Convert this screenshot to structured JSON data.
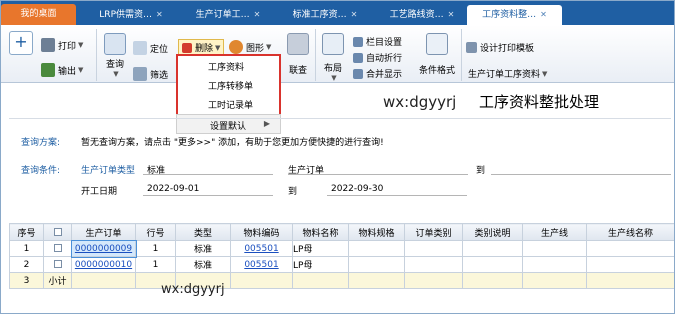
{
  "tabs": [
    {
      "label": "我的桌面"
    },
    {
      "label": "LRP供需资…"
    },
    {
      "label": "生产订单工…"
    },
    {
      "label": "标准工序资…"
    },
    {
      "label": "工艺路线资…"
    },
    {
      "label": "工序资料整…"
    }
  ],
  "ribbon": {
    "add": "+",
    "print": "打印",
    "output": "输出",
    "query": "查询",
    "locate": "定位",
    "filter": "筛选",
    "delete": "删除",
    "chart": "图形",
    "link": "联查",
    "layout": "布局",
    "col_settings": "栏目设置",
    "auto_wrap": "自动折行",
    "merge_display": "合并显示",
    "cond_format": "条件格式",
    "design_print": "设计打印模板",
    "mo_process": "生产订单工序资料"
  },
  "menu": {
    "items": [
      "工序资料",
      "工序转移单",
      "工时记录单"
    ],
    "defaults": "设置默认"
  },
  "watermark": "wx:dgyyrj",
  "page_title": "工序资料整批处理",
  "query": {
    "scheme_label": "查询方案:",
    "scheme_text": "暂无查询方案，请点击 \"更多>>\" 添加，有助于您更加方便快捷的进行查询!",
    "cond_label": "查询条件:",
    "mo_type_label": "生产订单类型",
    "mo_type_value": "标准",
    "mo_label": "生产订单",
    "to1": "到",
    "start_label": "开工日期",
    "start_from": "2022-09-01",
    "to2": "到",
    "start_to": "2022-09-30"
  },
  "table": {
    "headers": [
      "序号",
      "",
      "生产订单",
      "行号",
      "类型",
      "物料编码",
      "物料名称",
      "物料规格",
      "订单类别",
      "类别说明",
      "生产线",
      "生产线名称"
    ],
    "rows": [
      {
        "no": "1",
        "order": "0000000009",
        "line": "1",
        "type": "标准",
        "code": "005501",
        "name": "LP母"
      },
      {
        "no": "2",
        "order": "0000000010",
        "line": "1",
        "type": "标准",
        "code": "005501",
        "name": "LP母"
      }
    ],
    "subtotal": {
      "no": "3",
      "label": "小计"
    }
  }
}
